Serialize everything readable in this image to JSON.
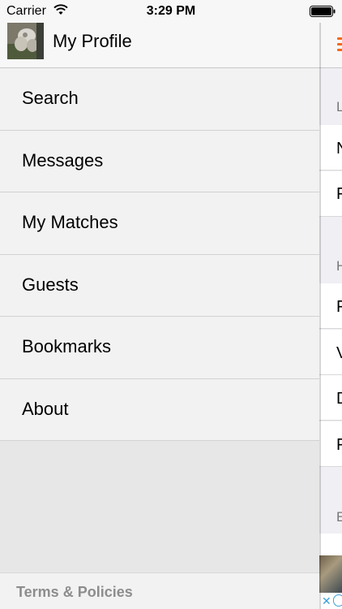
{
  "status_bar": {
    "carrier": "Carrier",
    "time": "3:29 PM",
    "icons": [
      "wifi-icon",
      "battery-icon"
    ]
  },
  "profile": {
    "title": "My Profile",
    "avatar_icon": "avatar"
  },
  "menu": {
    "items": [
      {
        "label": "Search"
      },
      {
        "label": "Messages"
      },
      {
        "label": "My Matches"
      },
      {
        "label": "Guests"
      },
      {
        "label": "Bookmarks"
      },
      {
        "label": "About"
      }
    ]
  },
  "footer": {
    "link": "Terms & Policies"
  },
  "background_screen": {
    "accent_color": "#f26a1b",
    "menu_icon": "hamburger-icon",
    "visible_fragments": [
      "L",
      "N",
      "F",
      "H",
      "F",
      "V",
      "D",
      "F",
      "E"
    ],
    "ad_icons": [
      "close-icon",
      "ad-choices-icon"
    ]
  }
}
